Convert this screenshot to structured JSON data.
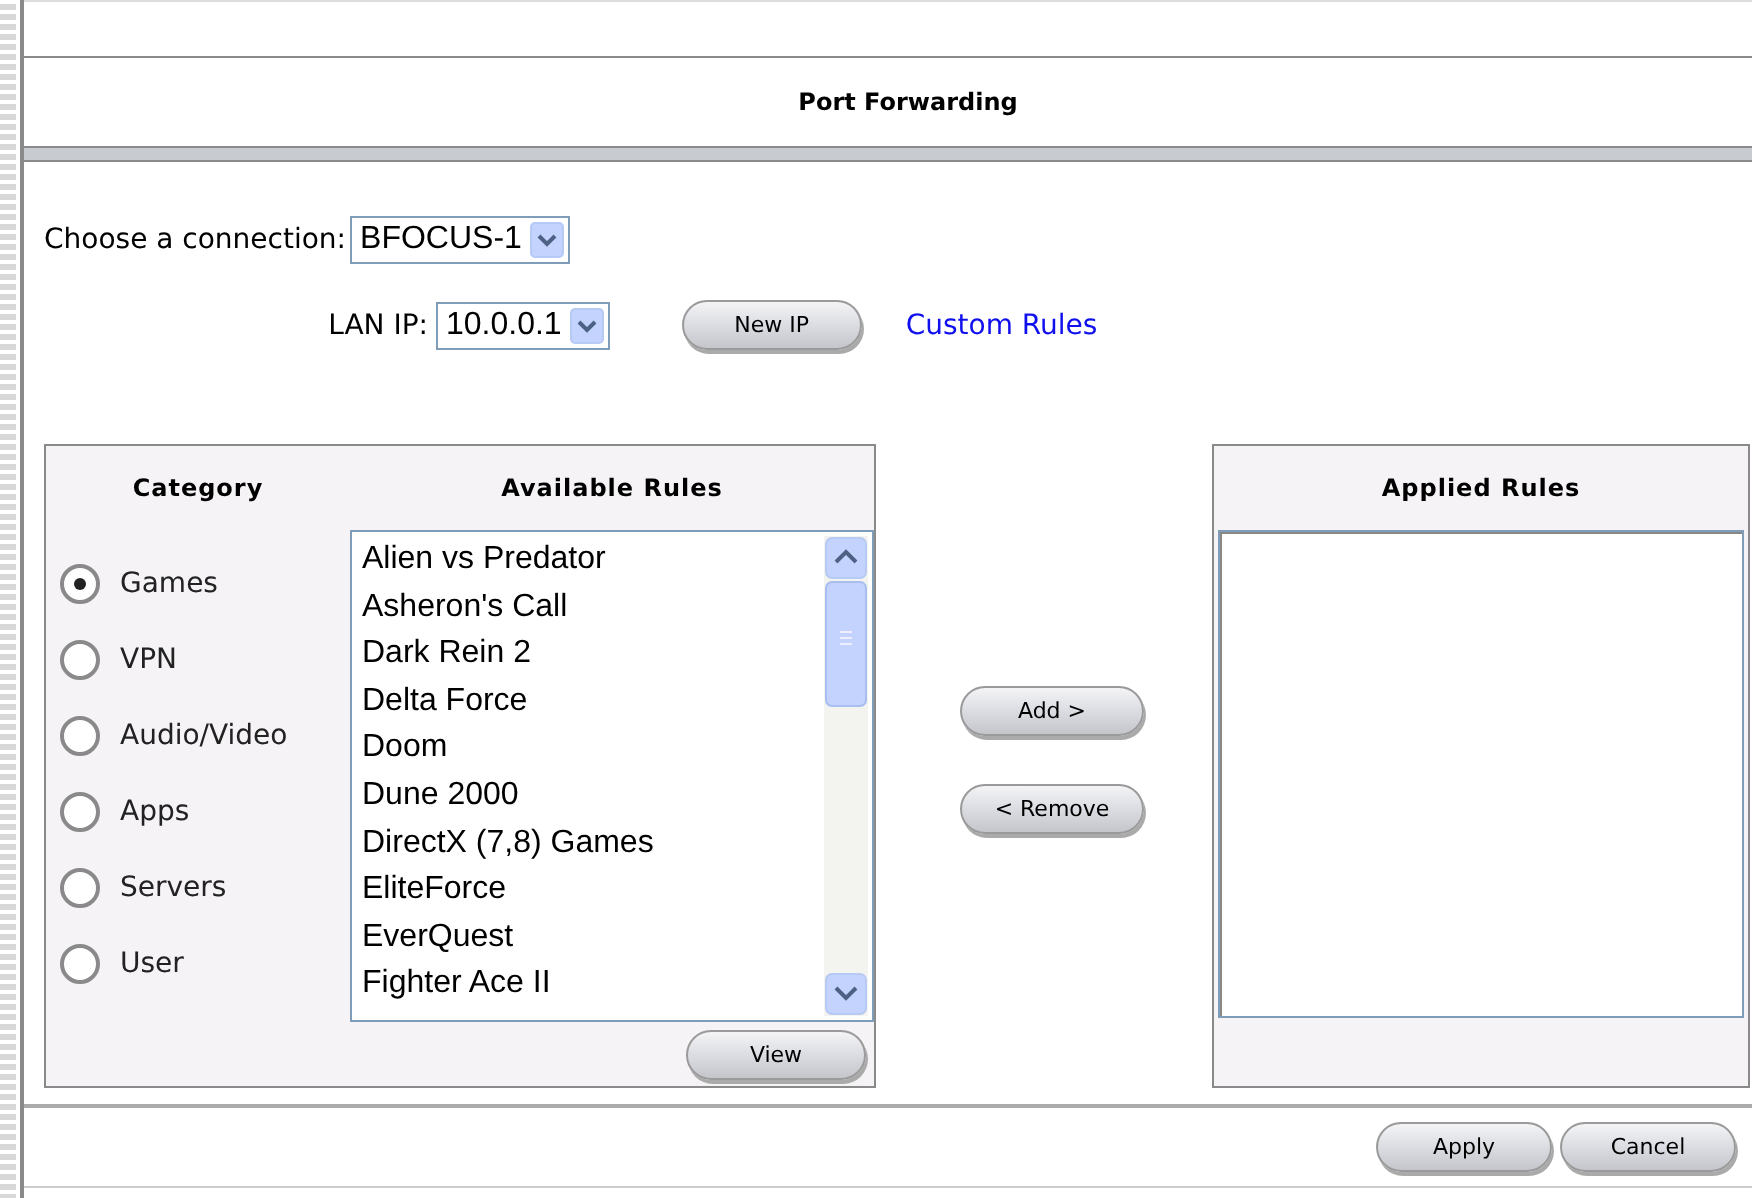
{
  "title": "Port Forwarding",
  "connection": {
    "label": "Choose a connection:",
    "value": "BFOCUS-1"
  },
  "lan_ip": {
    "label": "LAN IP:",
    "value": "10.0.0.1"
  },
  "new_ip_button": "New IP",
  "custom_rules_link": "Custom Rules",
  "category": {
    "heading": "Category",
    "options": [
      {
        "label": "Games",
        "selected": true
      },
      {
        "label": "VPN",
        "selected": false
      },
      {
        "label": "Audio/Video",
        "selected": false
      },
      {
        "label": "Apps",
        "selected": false
      },
      {
        "label": "Servers",
        "selected": false
      },
      {
        "label": "User",
        "selected": false
      }
    ]
  },
  "available_rules": {
    "heading": "Available Rules",
    "items": [
      "Alien vs Predator",
      "Asheron's Call",
      "Dark Rein 2",
      "Delta Force",
      "Doom",
      "Dune 2000",
      "DirectX (7,8) Games",
      "EliteForce",
      "EverQuest",
      "Fighter Ace II"
    ]
  },
  "view_button": "View",
  "add_button": "Add >",
  "remove_button": "< Remove",
  "applied_rules": {
    "heading": "Applied Rules"
  },
  "footer_buttons": [
    "Apply",
    "Cancel"
  ]
}
